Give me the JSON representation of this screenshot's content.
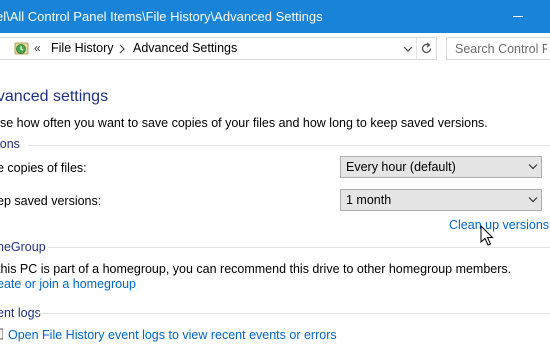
{
  "window": {
    "title": "el\\All Control Panel Items\\File History\\Advanced Settings"
  },
  "addressbar": {
    "back_sep": "«",
    "crumbs": [
      "File History",
      "Advanced Settings"
    ],
    "search_placeholder": "Search Control Pa"
  },
  "main": {
    "heading": "dvanced settings",
    "subtitle": "ose how often you want to save copies of your files and how long to keep saved versions.",
    "versions": {
      "section": "ions",
      "save_copies_label": "e copies of files:",
      "save_copies_value": "Every hour (default)",
      "keep_label": "ep saved versions:",
      "keep_value": "1 month",
      "cleanup_link": "Clean up versions"
    },
    "homegroup": {
      "section": "neGroup",
      "text": "this PC is part of a homegroup, you can recommend this drive to other homegroup members.",
      "link": "eate or join a homegroup"
    },
    "event_logs": {
      "section": "ent logs",
      "link": "Open File History event logs to view recent events or errors"
    }
  },
  "colors": {
    "titlebar": "#1883d7",
    "heading": "#1e3287",
    "link": "#0066cc",
    "dropdown_bg": "#e5e5e5"
  }
}
